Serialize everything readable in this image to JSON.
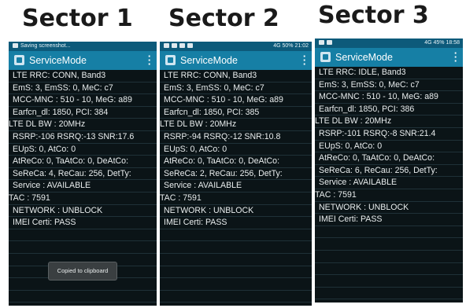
{
  "sectors": [
    {
      "title": "Sector 1",
      "statusbar": {
        "left": "Saving screenshot...",
        "right": ""
      },
      "app_title": "ServiceMode",
      "lines": [
        "LTE RRC: CONN, Band3",
        "EmS: 3, EmSS: 0, MeC: c7",
        "MCC-MNC : 510 - 10, MeG: a89",
        "Earfcn_dl: 1850, PCI: 384",
        "LTE DL BW : 20MHz",
        "RSRP:-106 RSRQ:-13 SNR:17.6",
        "EUpS: 0, AtCo: 0",
        "AtReCo: 0, TaAtCo: 0, DeAtCo:",
        "SeReCa: 4, ReCau: 256, DetTy:",
        "Service : AVAILABLE",
        "TAC : 7591",
        "NETWORK : UNBLOCK",
        "IMEI Certi: PASS"
      ],
      "toast": "Copied to clipboard"
    },
    {
      "title": "Sector 2",
      "statusbar": {
        "left": "",
        "right": "4G 50% 21:02"
      },
      "app_title": "ServiceMode",
      "lines": [
        "LTE RRC: CONN, Band3",
        "EmS: 3, EmSS: 0, MeC: c7",
        "MCC-MNC : 510 - 10, MeG: a89",
        "Earfcn_dl: 1850, PCI: 385",
        "LTE DL BW : 20MHz",
        "RSRP:-94 RSRQ:-12 SNR:10.8",
        "EUpS: 0, AtCo: 0",
        "AtReCo: 0, TaAtCo: 0, DeAtCo:",
        "SeReCa: 2, ReCau: 256, DetTy:",
        "Service : AVAILABLE",
        "TAC : 7591",
        "NETWORK : UNBLOCK",
        "IMEI Certi: PASS"
      ]
    },
    {
      "title": "Sector 3",
      "statusbar": {
        "left": "",
        "right": "4G 45% 18:58"
      },
      "app_title": "ServiceMode",
      "lines": [
        "LTE RRC: IDLE, Band3",
        "EmS: 3, EmSS: 0, MeC: c7",
        "MCC-MNC : 510 - 10, MeG: a89",
        "Earfcn_dl: 1850, PCI: 386",
        "LTE DL BW : 20MHz",
        "RSRP:-101 RSRQ:-8 SNR:21.4",
        "EUpS: 0, AtCo: 0",
        "AtReCo: 0, TaAtCo: 0, DeAtCo:",
        "SeReCa: 6, ReCau: 256, DetTy:",
        "Service : AVAILABLE",
        "TAC : 7591",
        "NETWORK : UNBLOCK",
        "IMEI Certi: PASS"
      ]
    }
  ]
}
